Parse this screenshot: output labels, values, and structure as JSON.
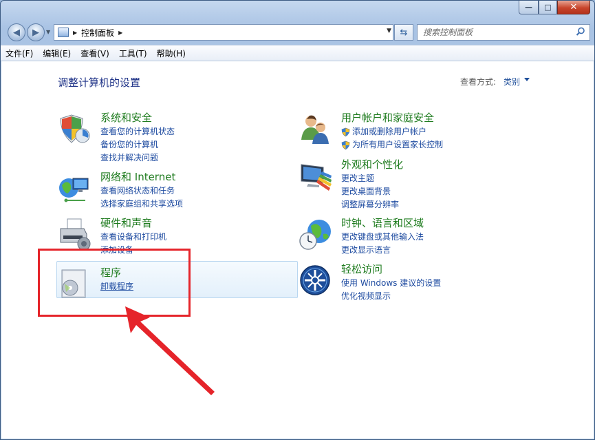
{
  "window": {
    "caption_buttons": {
      "minimize": "—",
      "maximize": "□",
      "close": "✕"
    }
  },
  "nav": {
    "address": "控制面板",
    "search_placeholder": "搜索控制面板"
  },
  "menubar": {
    "items": [
      "文件(F)",
      "编辑(E)",
      "查看(V)",
      "工具(T)",
      "帮助(H)"
    ]
  },
  "main": {
    "title": "调整计算机的设置",
    "view_label": "查看方式:",
    "view_value": "类别"
  },
  "categories": [
    {
      "title": "系统和安全",
      "icon": "shield-icon",
      "links": [
        "查看您的计算机状态",
        "备份您的计算机",
        "查找并解决问题"
      ]
    },
    {
      "title": "网络和 Internet",
      "icon": "network-icon",
      "links": [
        "查看网络状态和任务",
        "选择家庭组和共享选项"
      ]
    },
    {
      "title": "硬件和声音",
      "icon": "printer-icon",
      "links": [
        "查看设备和打印机",
        "添加设备"
      ]
    },
    {
      "title": "程序",
      "icon": "programs-icon",
      "links": [
        "卸载程序"
      ]
    },
    {
      "title": "用户帐户和家庭安全",
      "icon": "users-icon",
      "links": [
        "添加或删除用户帐户",
        "为所有用户设置家长控制"
      ]
    },
    {
      "title": "外观和个性化",
      "icon": "monitor-icon",
      "links": [
        "更改主题",
        "更改桌面背景",
        "调整屏幕分辨率"
      ]
    },
    {
      "title": "时钟、语言和区域",
      "icon": "globe-clock-icon",
      "links": [
        "更改键盘或其他输入法",
        "更改显示语言"
      ]
    },
    {
      "title": "轻松访问",
      "icon": "accessibility-icon",
      "links": [
        "使用 Windows 建议的设置",
        "优化视频显示"
      ]
    }
  ],
  "colors": {
    "category_title": "#1e7b1e",
    "link": "#1e4ba0",
    "page_title": "#1e3287",
    "annotation": "#e5242a"
  }
}
